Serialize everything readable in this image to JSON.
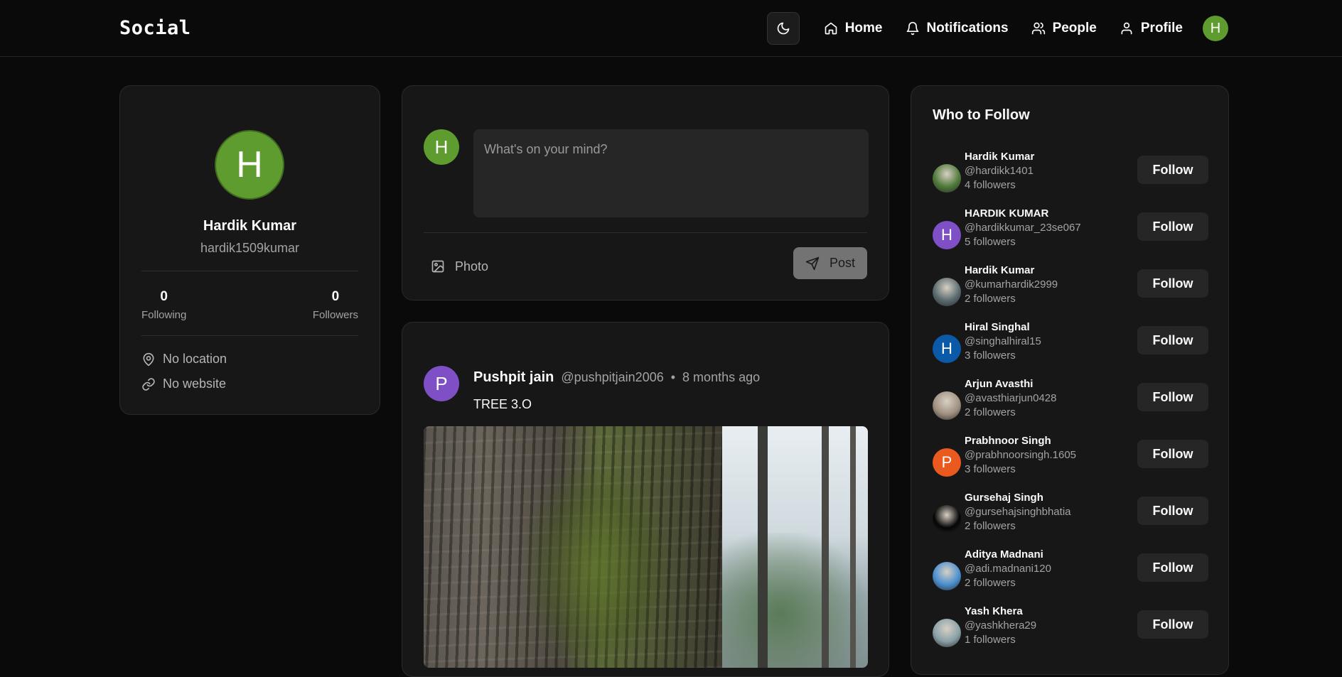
{
  "header": {
    "brand": "Social",
    "nav": [
      {
        "label": "Home",
        "icon": "home-icon"
      },
      {
        "label": "Notifications",
        "icon": "bell-icon"
      },
      {
        "label": "People",
        "icon": "users-icon"
      },
      {
        "label": "Profile",
        "icon": "user-icon"
      }
    ],
    "avatar_initial": "H",
    "avatar_color": "#5e9c2f"
  },
  "profile_card": {
    "avatar_initial": "H",
    "name": "Hardik Kumar",
    "username": "hardik1509kumar",
    "following_count": "0",
    "following_label": "Following",
    "followers_count": "0",
    "followers_label": "Followers",
    "location": "No location",
    "website": "No website"
  },
  "composer": {
    "avatar_initial": "H",
    "placeholder": "What's on your mind?",
    "photo_label": "Photo",
    "post_label": "Post"
  },
  "post": {
    "avatar_initial": "P",
    "avatar_color": "#7e4fc5",
    "author": "Pushpit jain",
    "handle": "@pushpitjain2006",
    "separator": "•",
    "time": "8 months ago",
    "text": "TREE 3.O"
  },
  "who_to_follow": {
    "title": "Who to Follow",
    "button_label": "Follow",
    "users": [
      {
        "name": "Hardik Kumar",
        "handle": "@hardikk1401",
        "followers": "4 followers",
        "avatar": "photo",
        "color": "#4f7a3a"
      },
      {
        "name": "HARDIK KUMAR",
        "handle": "@hardikkumar_23se067",
        "followers": "5 followers",
        "avatar": "H",
        "color": "#7e4fc5"
      },
      {
        "name": "Hardik Kumar",
        "handle": "@kumarhardik2999",
        "followers": "2 followers",
        "avatar": "photo",
        "color": "#5a6b70"
      },
      {
        "name": "Hiral Singhal",
        "handle": "@singhalhiral15",
        "followers": "3 followers",
        "avatar": "H",
        "color": "#0b5aa8"
      },
      {
        "name": "Arjun Avasthi",
        "handle": "@avasthiarjun0428",
        "followers": "2 followers",
        "avatar": "photo",
        "color": "#a09080"
      },
      {
        "name": "Prabhnoor Singh",
        "handle": "@prabhnoorsingh.1605",
        "followers": "3 followers",
        "avatar": "P",
        "color": "#ea5a1e"
      },
      {
        "name": "Gursehaj Singh",
        "handle": "@gursehajsinghbhatia",
        "followers": "2 followers",
        "avatar": "photo",
        "color": "#050505"
      },
      {
        "name": "Aditya Madnani",
        "handle": "@adi.madnani120",
        "followers": "2 followers",
        "avatar": "photo",
        "color": "#4a8fd0"
      },
      {
        "name": "Yash Khera",
        "handle": "@yashkhera29",
        "followers": "1 followers",
        "avatar": "photo",
        "color": "#8aa0a8"
      }
    ]
  }
}
